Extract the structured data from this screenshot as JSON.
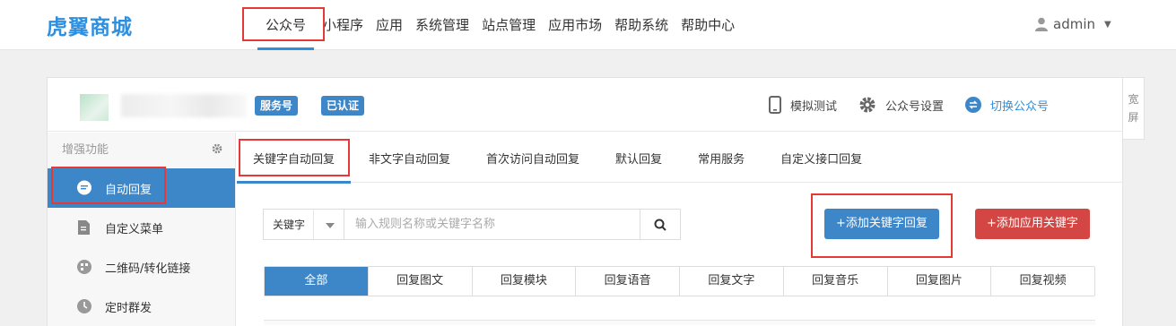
{
  "brand": {
    "logo_text": "虎翼商城"
  },
  "topnav": {
    "items": [
      "公众号",
      "小程序",
      "应用",
      "系统管理",
      "站点管理",
      "应用市场",
      "帮助系统",
      "帮助中心"
    ]
  },
  "user": {
    "name": "admin"
  },
  "account": {
    "badge_service": "服务号",
    "badge_verified": "已认证",
    "actions": [
      "模拟测试",
      "公众号设置",
      "切换公众号"
    ]
  },
  "sidebar": {
    "header": "增强功能",
    "items": [
      "自动回复",
      "自定义菜单",
      "二维码/转化链接",
      "定时群发"
    ]
  },
  "tabs": [
    "关键字自动回复",
    "非文字自动回复",
    "首次访问自动回复",
    "默认回复",
    "常用服务",
    "自定义接口回复"
  ],
  "search": {
    "select_value": "关键字",
    "placeholder": "输入规则名称或关键字名称"
  },
  "buttons": {
    "add_keyword_reply": "+添加关键字回复",
    "add_app_keyword": "+添加应用关键字"
  },
  "filters": [
    "全部",
    "回复图文",
    "回复模块",
    "回复语音",
    "回复文字",
    "回复音乐",
    "回复图片",
    "回复视频"
  ],
  "wide_toggle": "宽屏",
  "colors": {
    "accent": "#3d86c8",
    "danger": "#d34643",
    "highlight_box": "#e53935"
  }
}
